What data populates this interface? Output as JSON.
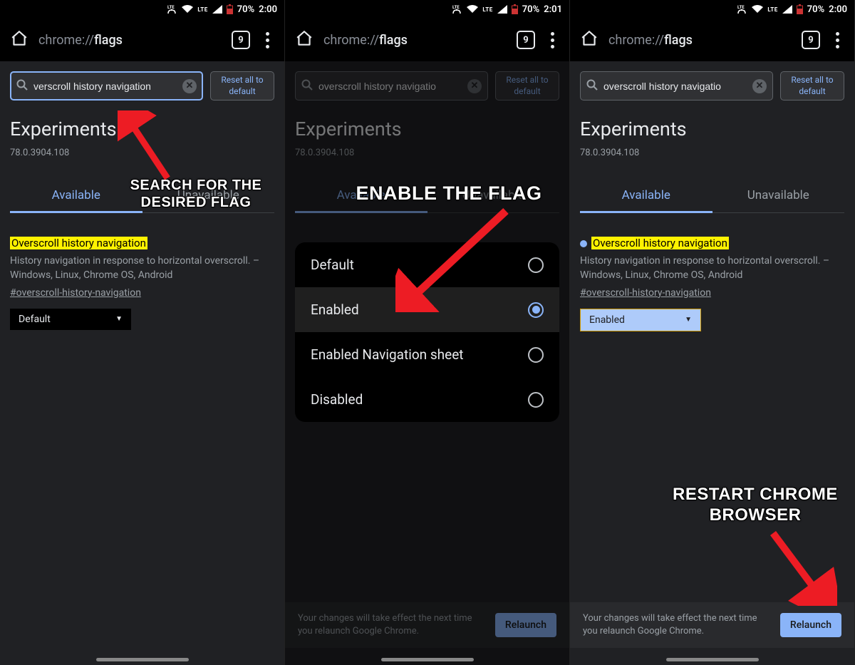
{
  "statusbar": {
    "battery_pct": "70%",
    "times": [
      "2:00",
      "2:01",
      "2:00"
    ],
    "lte": "LTE"
  },
  "toolbar": {
    "url_prefix": "chrome://",
    "url_bold": "flags",
    "tab_count": "9"
  },
  "search": {
    "reset_line1": "Reset all to",
    "reset_line2": "default",
    "values": [
      "verscroll history navigation",
      "overscroll history navigatio",
      "overscroll history navigatio"
    ]
  },
  "page": {
    "heading": "Experiments",
    "version": "78.0.3904.108",
    "tab_available": "Available",
    "tab_unavailable": "Unavailable"
  },
  "flag": {
    "title": "Overscroll history navigation",
    "desc": "History navigation in response to horizontal overscroll. – Windows, Linux, Chrome OS, Android",
    "hash": "#overscroll-history-navigation",
    "select_default": "Default",
    "select_enabled": "Enabled"
  },
  "options": [
    "Default",
    "Enabled",
    "Enabled Navigation sheet",
    "Disabled"
  ],
  "options_selected_index": 1,
  "relaunch": {
    "text": "Your changes will take effect the next time you relaunch Google Chrome.",
    "button": "Relaunch"
  },
  "annotations": {
    "a1_line1": "SEARCH FOR THE",
    "a1_line2": "DESIRED FLAG",
    "a2": "ENABLE THE FLAG",
    "a3_line1": "RESTART CHROME",
    "a3_line2": "BROWSER"
  }
}
